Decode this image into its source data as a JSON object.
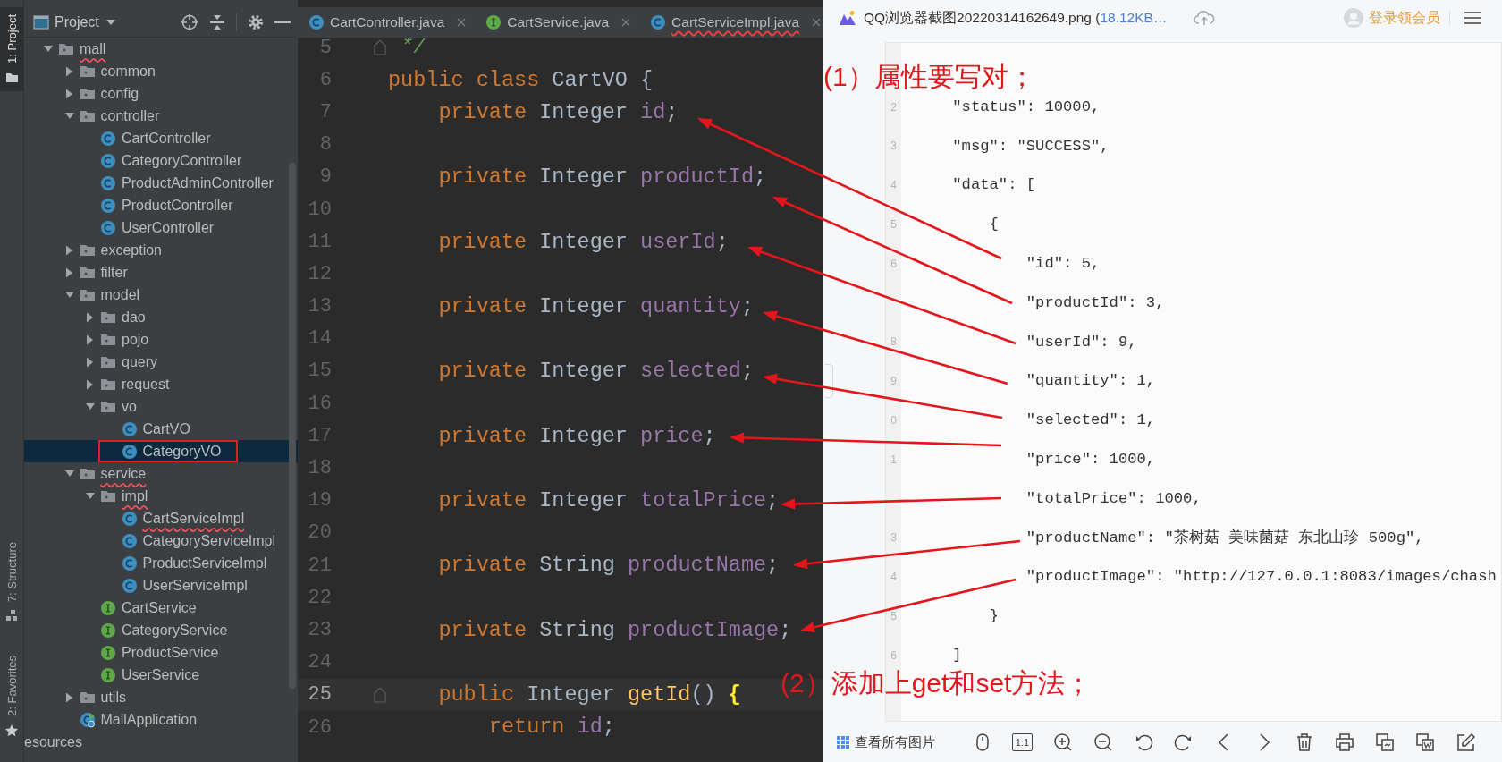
{
  "tool_strip": [
    {
      "label": "1: Project",
      "kind": "project",
      "selected": true
    },
    {
      "label": "7: Structure",
      "kind": "structure",
      "selected": false
    },
    {
      "label": "2: Favorites",
      "kind": "favorites",
      "selected": false
    }
  ],
  "project_panel": {
    "title": "Project",
    "tree": [
      {
        "label": "mall",
        "kind": "folder",
        "expanded": true,
        "error": true,
        "selected": false,
        "children": [
          {
            "label": "common",
            "kind": "folder",
            "expanded": false,
            "error": false,
            "selected": false
          },
          {
            "label": "config",
            "kind": "folder",
            "expanded": false,
            "error": false,
            "selected": false
          },
          {
            "label": "controller",
            "kind": "folder",
            "expanded": true,
            "error": false,
            "selected": false,
            "children": [
              {
                "label": "CartController",
                "kind": "class",
                "error": false,
                "selected": false
              },
              {
                "label": "CategoryController",
                "kind": "class",
                "error": false,
                "selected": false
              },
              {
                "label": "ProductAdminController",
                "kind": "class",
                "error": false,
                "selected": false
              },
              {
                "label": "ProductController",
                "kind": "class",
                "error": false,
                "selected": false
              },
              {
                "label": "UserController",
                "kind": "class",
                "error": false,
                "selected": false
              }
            ]
          },
          {
            "label": "exception",
            "kind": "folder",
            "expanded": false,
            "error": false,
            "selected": false
          },
          {
            "label": "filter",
            "kind": "folder",
            "expanded": false,
            "error": false,
            "selected": false
          },
          {
            "label": "model",
            "kind": "folder",
            "expanded": true,
            "error": false,
            "selected": false,
            "children": [
              {
                "label": "dao",
                "kind": "folder",
                "expanded": false,
                "error": false,
                "selected": false
              },
              {
                "label": "pojo",
                "kind": "folder",
                "expanded": false,
                "error": false,
                "selected": false
              },
              {
                "label": "query",
                "kind": "folder",
                "expanded": false,
                "error": false,
                "selected": false
              },
              {
                "label": "request",
                "kind": "folder",
                "expanded": false,
                "error": false,
                "selected": false
              },
              {
                "label": "vo",
                "kind": "folder",
                "expanded": true,
                "error": false,
                "selected": false,
                "children": [
                  {
                    "label": "CartVO",
                    "kind": "class",
                    "error": false,
                    "selected": false
                  },
                  {
                    "label": "CategoryVO",
                    "kind": "class",
                    "error": false,
                    "selected": true
                  }
                ]
              }
            ]
          },
          {
            "label": "service",
            "kind": "folder",
            "expanded": true,
            "error": true,
            "selected": false,
            "children": [
              {
                "label": "impl",
                "kind": "folder",
                "expanded": true,
                "error": true,
                "selected": false,
                "children": [
                  {
                    "label": "CartServiceImpl",
                    "kind": "class",
                    "error": true,
                    "selected": false
                  },
                  {
                    "label": "CategoryServiceImpl",
                    "kind": "class",
                    "error": false,
                    "selected": false
                  },
                  {
                    "label": "ProductServiceImpl",
                    "kind": "class",
                    "error": false,
                    "selected": false
                  },
                  {
                    "label": "UserServiceImpl",
                    "kind": "class",
                    "error": false,
                    "selected": false
                  }
                ]
              },
              {
                "label": "CartService",
                "kind": "interface",
                "error": false,
                "selected": false
              },
              {
                "label": "CategoryService",
                "kind": "interface",
                "error": false,
                "selected": false
              },
              {
                "label": "ProductService",
                "kind": "interface",
                "error": false,
                "selected": false
              },
              {
                "label": "UserService",
                "kind": "interface",
                "error": false,
                "selected": false
              }
            ]
          },
          {
            "label": "utils",
            "kind": "folder",
            "expanded": false,
            "error": false,
            "selected": false
          },
          {
            "label": "MallApplication",
            "kind": "application",
            "error": false,
            "selected": false
          }
        ]
      },
      {
        "label": "esources",
        "kind": "partial",
        "error": false,
        "selected": false
      }
    ]
  },
  "editor": {
    "tabs": [
      {
        "label": "CartController.java",
        "kind": "class",
        "error": false,
        "selected": false
      },
      {
        "label": "CartService.java",
        "kind": "interface",
        "error": false,
        "selected": false
      },
      {
        "label": "CartServiceImpl.java",
        "kind": "class",
        "error": true,
        "selected": false
      }
    ],
    "lines": [
      {
        "number": "5",
        "fold": true,
        "current": false,
        "tokens": [
          {
            "kind": "comment",
            "text": " */"
          }
        ]
      },
      {
        "number": "6",
        "fold": false,
        "current": false,
        "tokens": [
          {
            "kind": "keyword",
            "text": "public class"
          },
          {
            "kind": "plain",
            "text": " CartVO {"
          }
        ]
      },
      {
        "number": "7",
        "fold": false,
        "current": false,
        "tokens": [
          {
            "kind": "keyword",
            "text": "    private"
          },
          {
            "kind": "plain",
            "text": " Integer "
          },
          {
            "kind": "field",
            "text": "id"
          },
          {
            "kind": "plain",
            "text": ";"
          }
        ]
      },
      {
        "number": "8",
        "fold": false,
        "current": false
      },
      {
        "number": "9",
        "fold": false,
        "current": false,
        "tokens": [
          {
            "kind": "keyword",
            "text": "    private"
          },
          {
            "kind": "plain",
            "text": " Integer "
          },
          {
            "kind": "field",
            "text": "productId"
          },
          {
            "kind": "plain",
            "text": ";"
          }
        ]
      },
      {
        "number": "10",
        "fold": false,
        "current": false
      },
      {
        "number": "11",
        "fold": false,
        "current": false,
        "tokens": [
          {
            "kind": "keyword",
            "text": "    private"
          },
          {
            "kind": "plain",
            "text": " Integer "
          },
          {
            "kind": "field",
            "text": "userId"
          },
          {
            "kind": "plain",
            "text": ";"
          }
        ]
      },
      {
        "number": "12",
        "fold": false,
        "current": false
      },
      {
        "number": "13",
        "fold": false,
        "current": false,
        "tokens": [
          {
            "kind": "keyword",
            "text": "    private"
          },
          {
            "kind": "plain",
            "text": " Integer "
          },
          {
            "kind": "field",
            "text": "quantity"
          },
          {
            "kind": "plain",
            "text": ";"
          }
        ]
      },
      {
        "number": "14",
        "fold": false,
        "current": false
      },
      {
        "number": "15",
        "fold": false,
        "current": false,
        "tokens": [
          {
            "kind": "keyword",
            "text": "    private"
          },
          {
            "kind": "plain",
            "text": " Integer "
          },
          {
            "kind": "field",
            "text": "selected"
          },
          {
            "kind": "plain",
            "text": ";"
          }
        ]
      },
      {
        "number": "16",
        "fold": false,
        "current": false
      },
      {
        "number": "17",
        "fold": false,
        "current": false,
        "tokens": [
          {
            "kind": "keyword",
            "text": "    private"
          },
          {
            "kind": "plain",
            "text": " Integer "
          },
          {
            "kind": "field",
            "text": "price"
          },
          {
            "kind": "plain",
            "text": ";"
          }
        ]
      },
      {
        "number": "18",
        "fold": false,
        "current": false
      },
      {
        "number": "19",
        "fold": false,
        "current": false,
        "tokens": [
          {
            "kind": "keyword",
            "text": "    private"
          },
          {
            "kind": "plain",
            "text": " Integer "
          },
          {
            "kind": "field",
            "text": "totalPrice"
          },
          {
            "kind": "plain",
            "text": ";"
          }
        ]
      },
      {
        "number": "20",
        "fold": false,
        "current": false
      },
      {
        "number": "21",
        "fold": false,
        "current": false,
        "tokens": [
          {
            "kind": "keyword",
            "text": "    private"
          },
          {
            "kind": "plain",
            "text": " String "
          },
          {
            "kind": "field",
            "text": "productName"
          },
          {
            "kind": "plain",
            "text": ";"
          }
        ]
      },
      {
        "number": "22",
        "fold": false,
        "current": false
      },
      {
        "number": "23",
        "fold": false,
        "current": false,
        "tokens": [
          {
            "kind": "keyword",
            "text": "    private"
          },
          {
            "kind": "plain",
            "text": " String "
          },
          {
            "kind": "field",
            "text": "productImage"
          },
          {
            "kind": "plain",
            "text": ";"
          }
        ]
      },
      {
        "number": "24",
        "fold": false,
        "current": false
      },
      {
        "number": "25",
        "fold": true,
        "current": true,
        "tokens": [
          {
            "kind": "keyword",
            "text": "    public"
          },
          {
            "kind": "plain",
            "text": " Integer "
          },
          {
            "kind": "method",
            "text": "getId"
          },
          {
            "kind": "plain",
            "text": "() "
          },
          {
            "kind": "brace",
            "text": "{"
          }
        ]
      },
      {
        "number": "26",
        "fold": false,
        "current": false,
        "tokens": [
          {
            "kind": "keyword",
            "text": "        return "
          },
          {
            "kind": "field",
            "text": "id"
          },
          {
            "kind": "plain",
            "text": ";"
          }
        ]
      }
    ]
  },
  "viewer": {
    "title": "QQ浏览器截图20220314162649.png (",
    "size": "18.12KB…",
    "login": "登录领会员",
    "lines": [
      {
        "number": "2",
        "text": "    \"status\": 10000,"
      },
      {
        "number": "3",
        "text": "    \"msg\": \"SUCCESS\","
      },
      {
        "number": "4",
        "text": "    \"data\": ["
      },
      {
        "number": "5",
        "text": "        {"
      },
      {
        "number": "6",
        "text": "            \"id\": 5,"
      },
      {
        "text": "            \"productId\": 3,"
      },
      {
        "number": "8",
        "text": "            \"userId\": 9,"
      },
      {
        "number": "9",
        "text": "            \"quantity\": 1,"
      },
      {
        "number": "0",
        "text": "            \"selected\": 1,"
      },
      {
        "number": "1",
        "text": "            \"price\": 1000,"
      },
      {
        "text": "            \"totalPrice\": 1000,"
      },
      {
        "number": "3",
        "text": "            \"productName\": \"茶树菇 美味菌菇 东北山珍 500g\","
      },
      {
        "number": "4",
        "text": "            \"productImage\": \"http://127.0.0.1:8083/images/chash"
      },
      {
        "number": "5",
        "text": "        }"
      },
      {
        "number": "6",
        "text": "    ]"
      }
    ],
    "toolbar": [
      {
        "kind": "all_images",
        "label": "查看所有图片"
      },
      {
        "kind": "mouse"
      },
      {
        "kind": "actual_size",
        "label": "1:1"
      },
      {
        "kind": "zoom_in"
      },
      {
        "kind": "zoom_out"
      },
      {
        "kind": "rotate_left"
      },
      {
        "kind": "rotate_right"
      },
      {
        "kind": "prev"
      },
      {
        "kind": "next"
      },
      {
        "kind": "delete"
      },
      {
        "kind": "print"
      },
      {
        "kind": "convert"
      },
      {
        "kind": "stack"
      },
      {
        "kind": "edit"
      }
    ]
  },
  "annotations": [
    {
      "text": "(1）属性要写对；"
    },
    {
      "text": "(2）添加上get和set方法；"
    }
  ]
}
